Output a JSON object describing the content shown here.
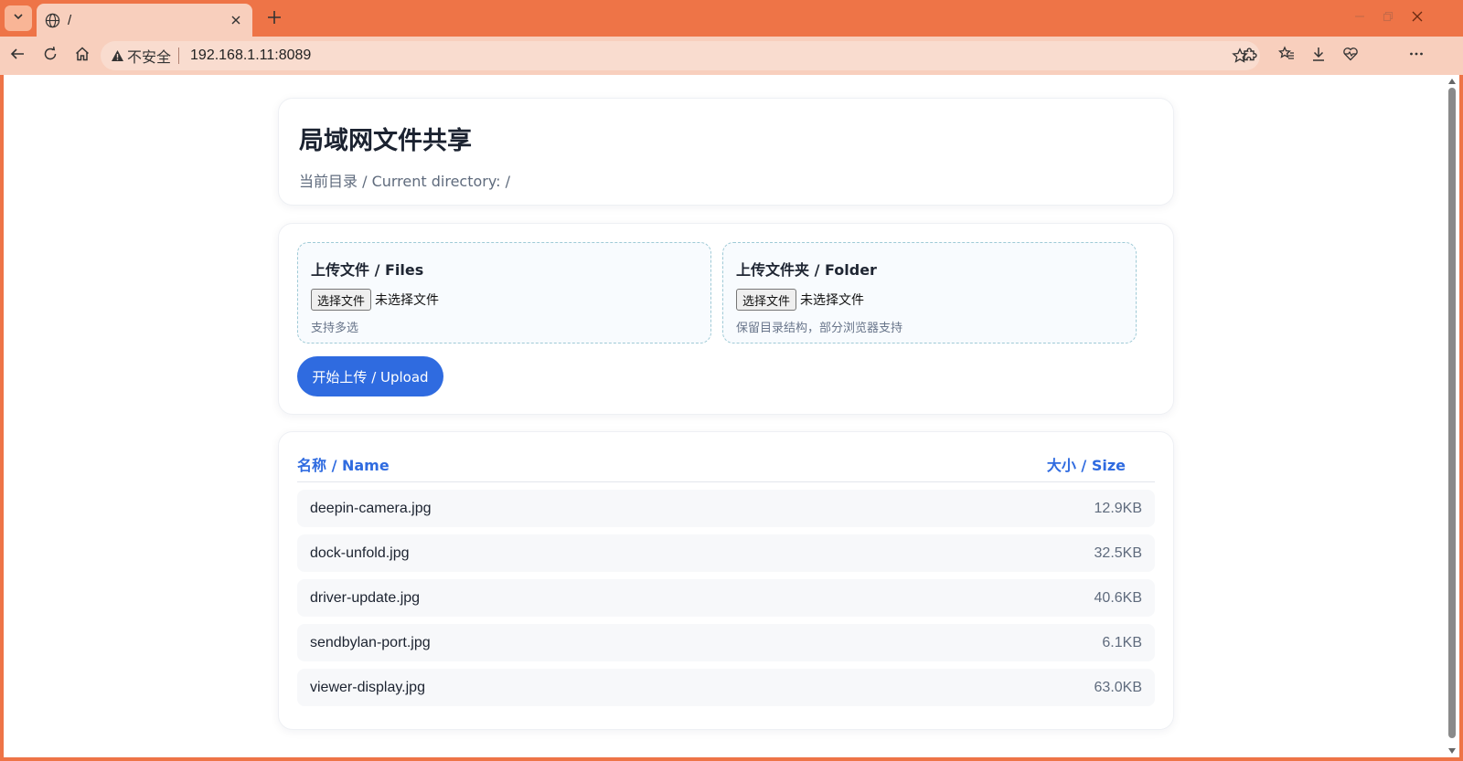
{
  "browser": {
    "tab_title": "/",
    "insecure_label": "不安全",
    "url": "192.168.1.11:8089",
    "accent_color": "#ee7447"
  },
  "page": {
    "title": "局域网文件共享",
    "current_directory": "当前目录 / Current directory: /"
  },
  "upload": {
    "files": {
      "title": "上传文件 / Files",
      "choose_button": "选择文件",
      "status": "未选择文件",
      "hint": "支持多选"
    },
    "folder": {
      "title": "上传文件夹 / Folder",
      "choose_button": "选择文件",
      "status": "未选择文件",
      "hint": "保留目录结构，部分浏览器支持"
    },
    "submit_label": "开始上传 / Upload",
    "button_color": "#2f6be0"
  },
  "listing": {
    "columns": {
      "name": "名称 / Name",
      "size": "大小 / Size"
    },
    "files": [
      {
        "name": "deepin-camera.jpg",
        "size": "12.9KB"
      },
      {
        "name": "dock-unfold.jpg",
        "size": "32.5KB"
      },
      {
        "name": "driver-update.jpg",
        "size": "40.6KB"
      },
      {
        "name": "sendbylan-port.jpg",
        "size": "6.1KB"
      },
      {
        "name": "viewer-display.jpg",
        "size": "63.0KB"
      }
    ]
  }
}
